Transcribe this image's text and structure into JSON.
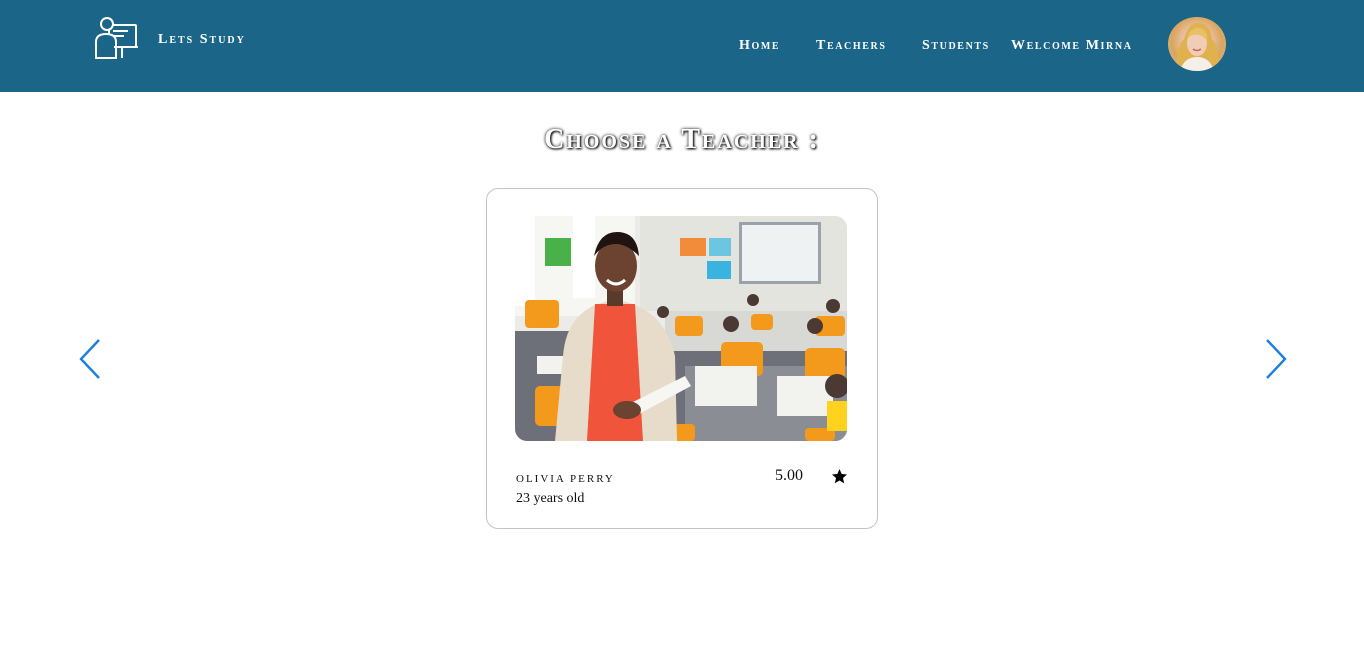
{
  "header": {
    "brand": "Lets Study",
    "nav": [
      {
        "label": "Home"
      },
      {
        "label": "Teachers"
      },
      {
        "label": "Students"
      },
      {
        "label": "Welcome Mirna"
      }
    ]
  },
  "main": {
    "title": "Choose a Teacher :"
  },
  "teacher_card": {
    "name": "OLIVIA PERRY",
    "age": "23 years old",
    "rating": "5.00"
  },
  "icons": {
    "logo": "teacher-at-screen-icon",
    "prev": "chevron-left-icon",
    "next": "chevron-right-icon",
    "rating": "star-icon"
  },
  "colors": {
    "header_bg": "#1b6588",
    "accent": "#1a7fe0"
  }
}
